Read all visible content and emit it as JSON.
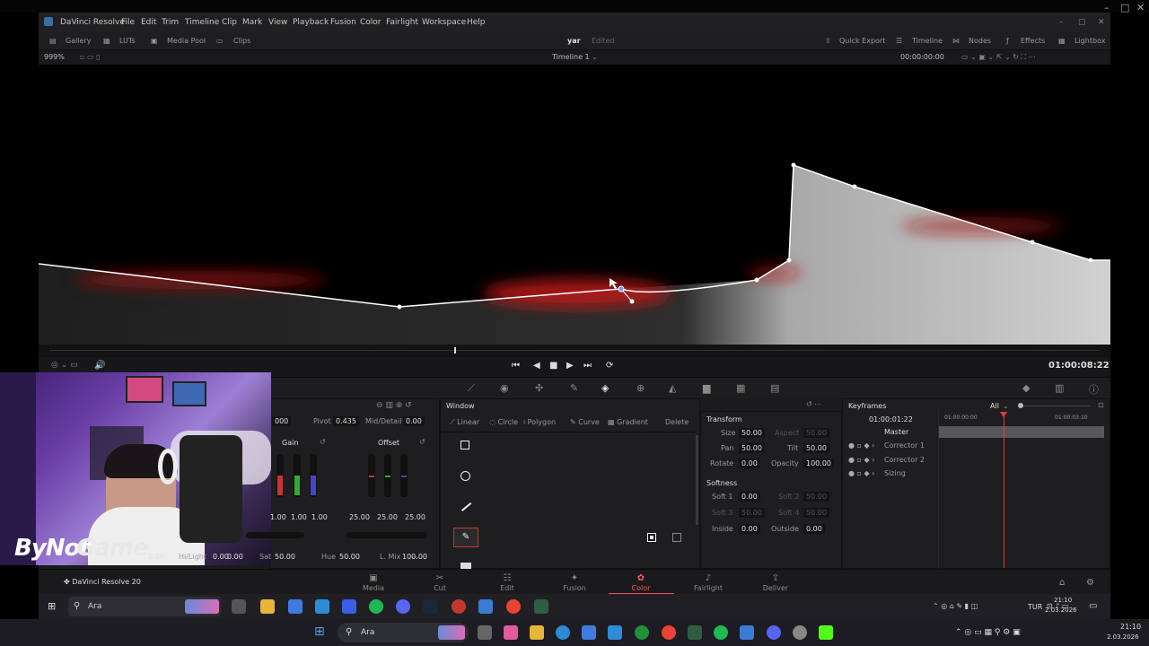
{
  "app": {
    "title": "DaVinci Resolve",
    "brand": "DaVinci Resolve 20"
  },
  "menu": [
    "File",
    "Edit",
    "Trim",
    "Timeline",
    "Clip",
    "Mark",
    "View",
    "Playback",
    "Fusion",
    "Color",
    "Fairlight",
    "Workspace",
    "Help"
  ],
  "toolbar": {
    "left": [
      "Gallery",
      "LUTs",
      "Media Pool",
      "Clips"
    ],
    "project": "yar",
    "project_status": "Edited",
    "right": [
      "Quick Export",
      "Timeline",
      "Nodes",
      "Effects",
      "Lightbox"
    ]
  },
  "viewer_bar": {
    "zoom": "999%",
    "timeline": "Timeline 1",
    "timecode": "00:00:00:00"
  },
  "transport": {
    "timecode": "01:00:08:22"
  },
  "primaries": {
    "top": {
      "value0": "000",
      "pivot_label": "Pivot",
      "pivot": "0.435",
      "middetail_label": "Mid/Detail",
      "middetail": "0.00"
    },
    "gain_label": "Gain",
    "offset_label": "Offset",
    "gain_vals": [
      "1.00",
      "1.00",
      "1.00"
    ],
    "offset_vals": [
      "25.00",
      "25.00",
      "25.00"
    ],
    "bottom": {
      "c_val": "0.00",
      "hl_label": "Hi/Light",
      "hl": "0.00",
      "sat_label": "Sat",
      "sat": "50.00",
      "hue_label": "Hue",
      "hue": "50.00",
      "lmix_label": "L. Mix",
      "lmix": "100.00"
    }
  },
  "window": {
    "title": "Window",
    "tools": [
      "Linear",
      "Circle",
      "Polygon",
      "Curve",
      "Gradient"
    ],
    "delete": "Delete"
  },
  "transform": {
    "title": "Transform",
    "size_label": "Size",
    "size": "50.00",
    "aspect_label": "Aspect",
    "aspect": "50.00",
    "pan_label": "Pan",
    "pan": "50.00",
    "tilt_label": "Tilt",
    "tilt": "50.00",
    "rotate_label": "Rotate",
    "rotate": "0.00",
    "opacity_label": "Opacity",
    "opacity": "100.00",
    "softness_title": "Softness",
    "soft1_label": "Soft 1",
    "soft1": "0.00",
    "soft2_label": "Soft 2",
    "soft2": "50.00",
    "soft3_label": "Soft 3",
    "soft3": "50.00",
    "soft4_label": "Soft 4",
    "soft4": "50.00",
    "inside_label": "Inside",
    "inside": "0.00",
    "outside_label": "Outside",
    "outside": "0.00"
  },
  "keyframes": {
    "title": "Keyframes",
    "filter": "All",
    "current": "01:00:01:22",
    "ruler_start": "01:00:00:00",
    "ruler_end": "01:00:03:10",
    "tracks": [
      "Master",
      "Corrector 1",
      "Corrector 2",
      "Sizing"
    ]
  },
  "pages": [
    "Media",
    "Cut",
    "Edit",
    "Fusion",
    "Color",
    "Fairlight",
    "Deliver"
  ],
  "active_page": "Color",
  "watermark": {
    "a": "ByNot",
    "b": "Game",
    "c": ".com"
  },
  "inner_taskbar": {
    "search": "Ara",
    "lang": "TUR",
    "time": "21:10",
    "date": "2.03.2026"
  },
  "outer_taskbar": {
    "search": "Ara",
    "time": "21:10",
    "date": "2.03.2026"
  },
  "colors": {
    "accent": "#ff4d4d",
    "curve": "#ffffff",
    "playhead": "#e43a3a"
  }
}
